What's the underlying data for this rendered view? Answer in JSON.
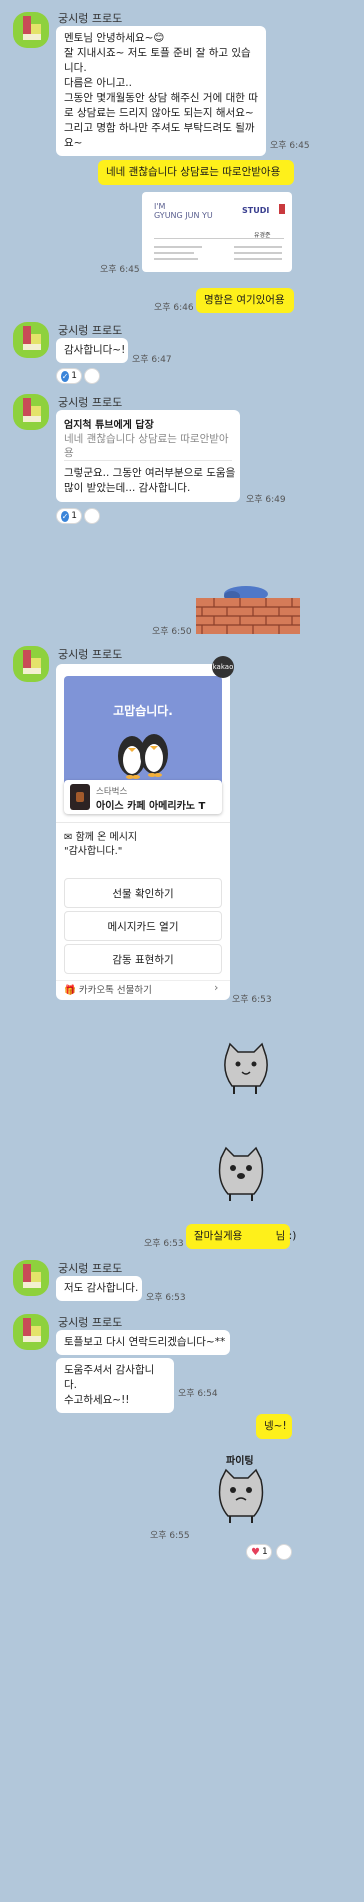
{
  "sender_name": "궁시렁 프로도",
  "messages": {
    "m1_text": "멘토님 안녕하세요~😊\n잘 지내시죠~ 저도 토플 준비 잘 하고 있습니다.\n다름은 아니고..\n그동안 몇개월동안 상담 해주신 거에 대한 따로 상담료는 드리지 않아도 되는지 해서요~ 그리고 명함 하나만 주셔도 부탁드려도 될까요~",
    "m1_time": "오후 6:45",
    "m2_text": "네네 괜찮습니다 상담료는 따로안받아용",
    "card_im": "I'M",
    "card_name": "GYUNG JUN YU",
    "card_logo": "STUDI",
    "card_kname": "유경준",
    "m3_time": "오후 6:45",
    "m4_text": "명함은 여기있어용",
    "m4_time": "오후 6:46",
    "m5_text": "감사합니다~!",
    "m5_time": "오후 6:47",
    "m5_react": "1",
    "reply_header": "엄지척 튜브에게 답장",
    "reply_quote": "네네 괜찮습니다 상담료는 따로안받아용",
    "reply_text": "그렇군요.. 그동안 여러부분으로 도움을 많이 받았는데... 감사합니다.",
    "reply_time": "오후 6:49",
    "reply_react": "1",
    "sticker1_time": "오후 6:50",
    "gift": {
      "badge": "kakao",
      "banner": "고맙습니다.",
      "brand": "스타벅스",
      "product": "아이스 카페 아메리카노 T",
      "msg_label": "함께 온 메시지",
      "msg_text": "\"감사합니다.\"",
      "btn1": "선물 확인하기",
      "btn2": "메시지카드 열기",
      "btn3": "감동 표현하기",
      "footer": "카카오톡 선물하기",
      "time": "오후 6:53"
    },
    "m6_text": "잘마실게용          님 :)",
    "m6_time": "오후 6:53",
    "m7_text": "저도 감사합니다.",
    "m7_time": "오후 6:53",
    "m8_text": "토플보고 다시 연락드리겠습니다~**",
    "m9_text": "도움주셔서 감사합니다.\n수고하세요~!!",
    "m9_time": "오후 6:54",
    "m10_text": "넹~!",
    "sticker_text": "파이팅",
    "sticker2_time": "오후 6:55",
    "final_react": "1"
  }
}
